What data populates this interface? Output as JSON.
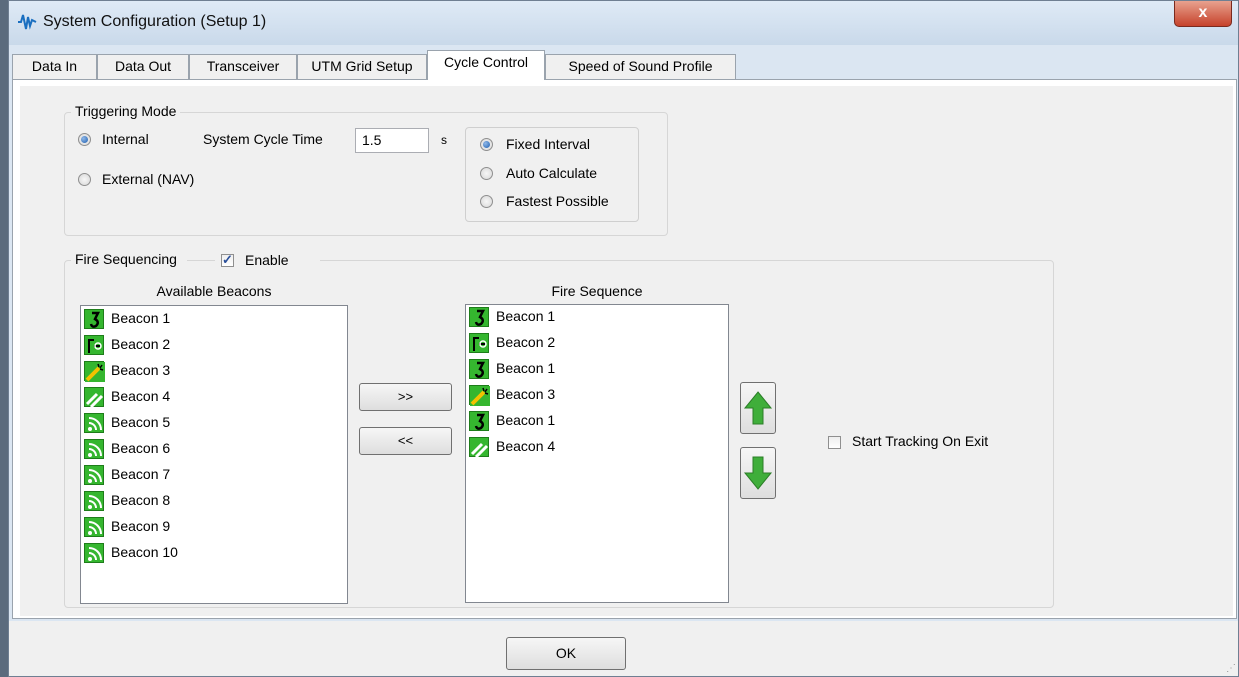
{
  "window": {
    "title": "System Configuration (Setup 1)",
    "close_label": "x"
  },
  "tabs": [
    "Data In",
    "Data Out",
    "Transceiver",
    "UTM Grid Setup",
    "Cycle Control",
    "Speed of Sound Profile"
  ],
  "active_tab": "Cycle Control",
  "triggering": {
    "legend": "Triggering Mode",
    "internal_label": "Internal",
    "external_label": "External (NAV)",
    "selected": "Internal",
    "cycle_time_label": "System Cycle Time",
    "cycle_time_value": "1.5",
    "cycle_time_unit": "s",
    "interval_options": [
      "Fixed Interval",
      "Auto Calculate",
      "Fastest Possible"
    ],
    "interval_selected": "Fixed Interval"
  },
  "fire_sequencing": {
    "legend": "Fire Sequencing",
    "enable_label": "Enable",
    "enable_checked": true,
    "available_header": "Available Beacons",
    "available": [
      {
        "name": "Beacon 1",
        "icon": "hook-icon"
      },
      {
        "name": "Beacon 2",
        "icon": "connector-icon"
      },
      {
        "name": "Beacon 3",
        "icon": "wand-icon"
      },
      {
        "name": "Beacon 4",
        "icon": "stripe-icon"
      },
      {
        "name": "Beacon 5",
        "icon": "signal-icon"
      },
      {
        "name": "Beacon 6",
        "icon": "signal-icon"
      },
      {
        "name": "Beacon 7",
        "icon": "signal-icon"
      },
      {
        "name": "Beacon 8",
        "icon": "signal-icon"
      },
      {
        "name": "Beacon 9",
        "icon": "signal-icon"
      },
      {
        "name": "Beacon 10",
        "icon": "signal-icon"
      }
    ],
    "sequence_header": "Fire Sequence",
    "sequence": [
      {
        "name": "Beacon 1",
        "icon": "hook-icon"
      },
      {
        "name": "Beacon 2",
        "icon": "connector-icon"
      },
      {
        "name": "Beacon 1",
        "icon": "hook-icon"
      },
      {
        "name": "Beacon 3",
        "icon": "wand-icon"
      },
      {
        "name": "Beacon 1",
        "icon": "hook-icon"
      },
      {
        "name": "Beacon 4",
        "icon": "stripe-icon"
      }
    ],
    "add_label": ">>",
    "remove_label": "<<",
    "start_tracking_label": "Start Tracking On Exit",
    "start_tracking_checked": false
  },
  "ok_label": "OK",
  "colors": {
    "icon_green": "#35b62f",
    "arrow_green": "#3fae3a",
    "radio_blue": "#1f5fb0"
  }
}
